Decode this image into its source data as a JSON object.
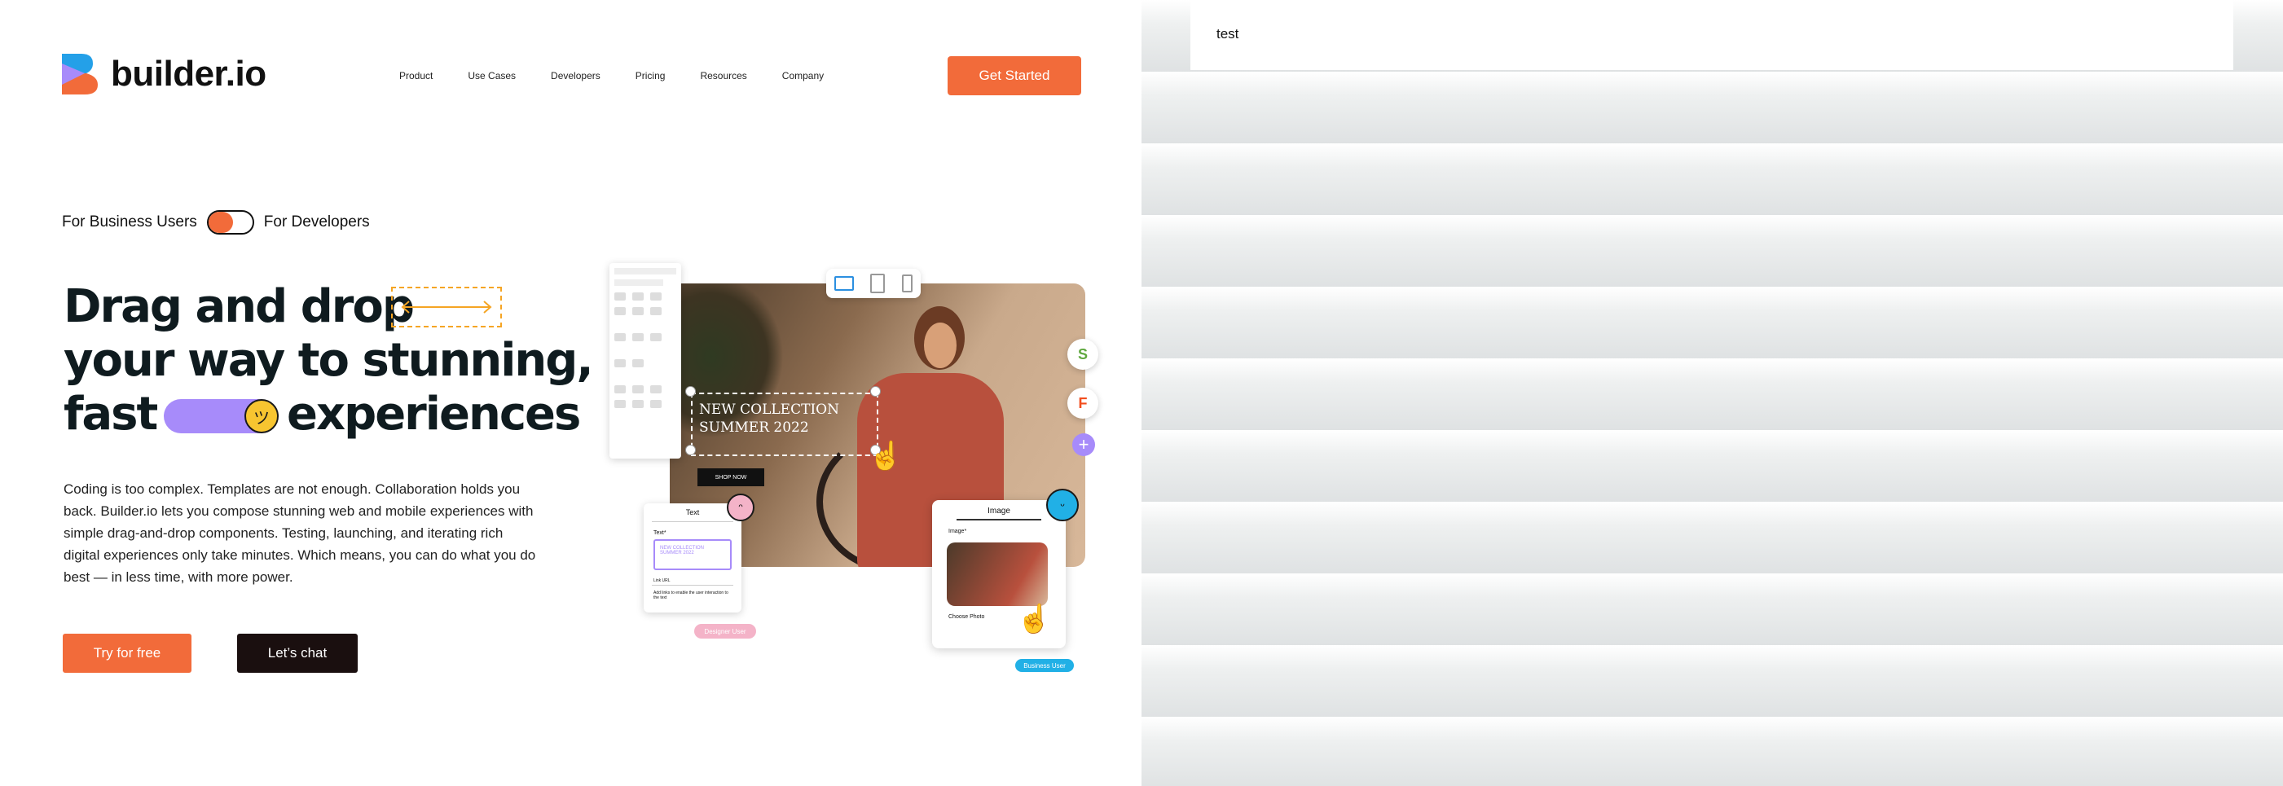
{
  "brand": {
    "name": "builder.io",
    "accent": "#f26b3a",
    "purple": "#a78bfa",
    "blue": "#21b0e6"
  },
  "nav": {
    "items": [
      "Product",
      "Use Cases",
      "Developers",
      "Pricing",
      "Resources",
      "Company"
    ],
    "cta": "Get Started"
  },
  "toggle": {
    "left_label": "For Business Users",
    "right_label": "For Developers",
    "active": "For Business Users"
  },
  "hero": {
    "line1": "Drag and drop",
    "line2": "your  way to stunning,",
    "line3a": "fast",
    "line3b": "experiences",
    "paragraph": "Coding is too complex. Templates are not enough. Collaboration holds you back. Builder.io lets you compose stunning web and mobile experiences with simple drag-and-drop components. Testing, launching, and iterating rich digital experiences only take minutes. Which means, you can do what you do best — in less time, with more power.",
    "try_label": "Try for free",
    "chat_label": "Let’s chat"
  },
  "illustration": {
    "banner_title_1": "NEW COLLECTION",
    "banner_title_2": "SUMMER 2022",
    "shop_label": "SHOP NOW",
    "text_card_title": "Text",
    "text_card_field": "Text*",
    "text_card_value": "NEW COLLECTION SUMMER 2022",
    "text_card_link_label": "Link URL",
    "text_card_note": "Add links to enable the user interaction to the text",
    "image_card_title": "Image",
    "image_card_field": "Image*",
    "image_card_choose": "Choose Photo",
    "designer_badge": "Designer User",
    "business_badge": "Business User"
  },
  "right_pane": {
    "text": "test"
  }
}
